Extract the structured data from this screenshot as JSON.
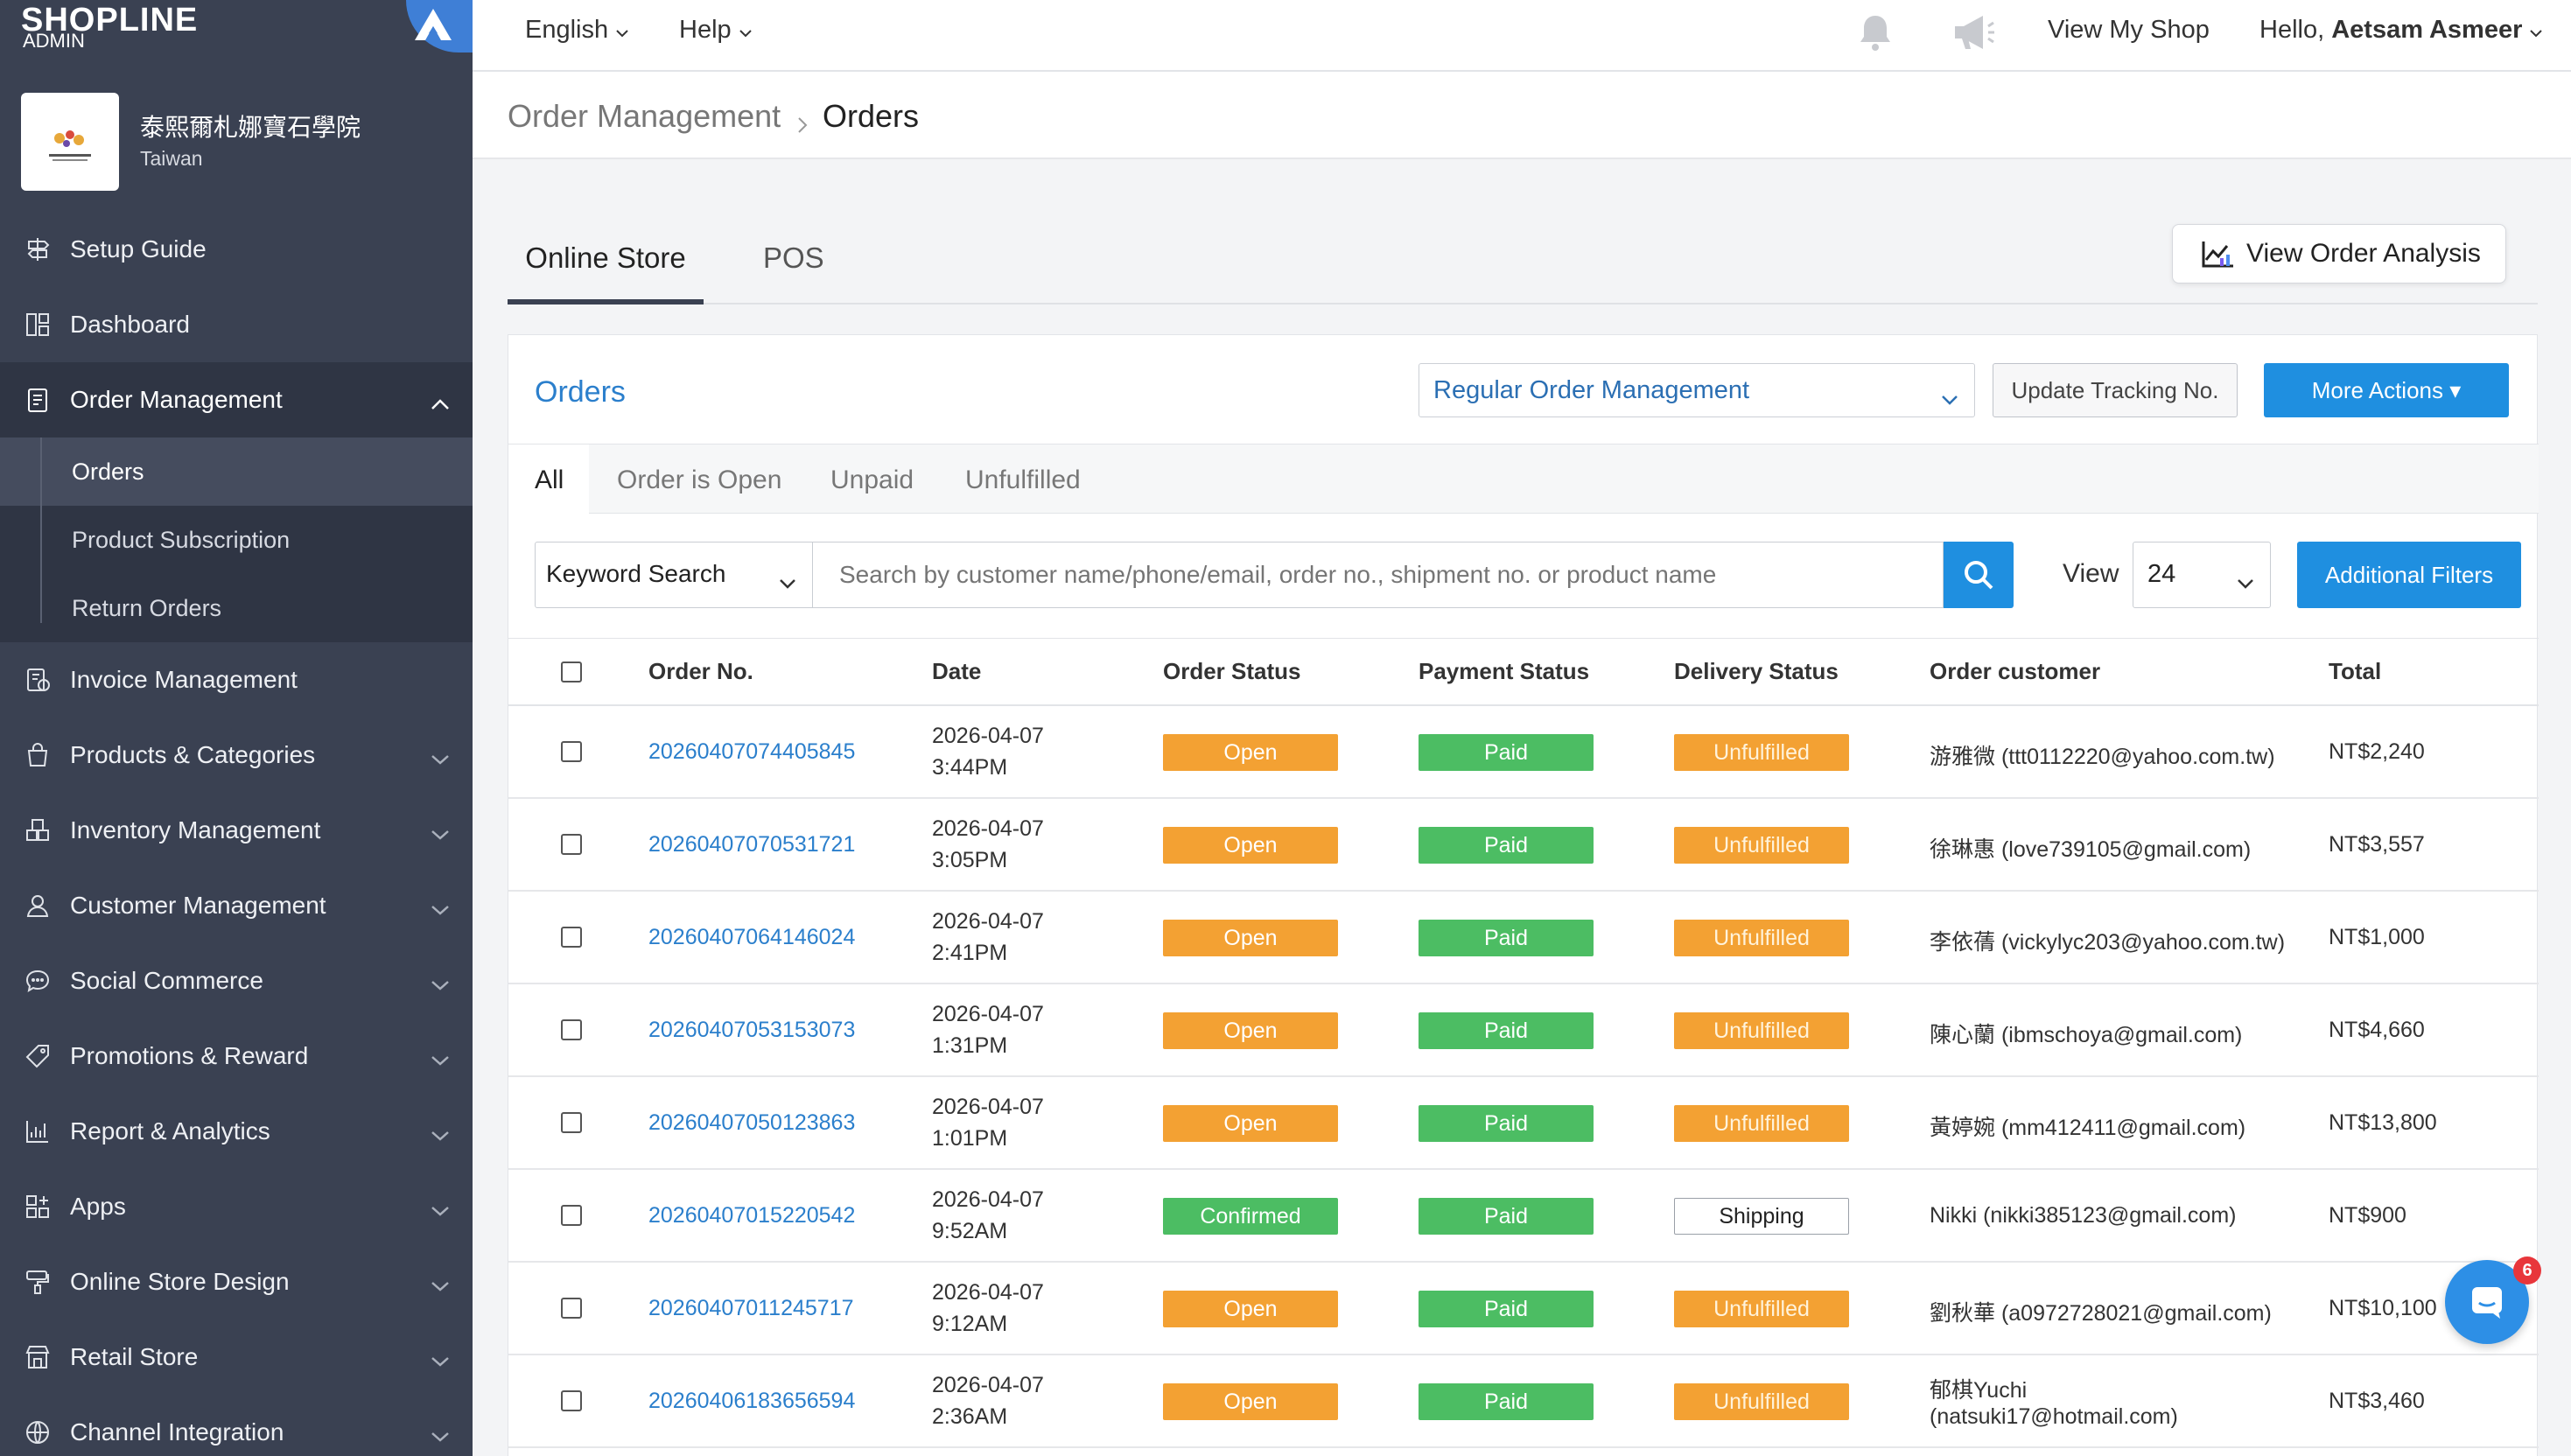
{
  "brand": {
    "logo": "SHOPLINE",
    "sub": "ADMIN"
  },
  "store": {
    "name": "泰熙爾札娜寶石學院",
    "region": "Taiwan"
  },
  "sidebar": {
    "items": [
      {
        "label": "Setup Guide",
        "icon": "signpost-icon"
      },
      {
        "label": "Dashboard",
        "icon": "dashboard-icon"
      },
      {
        "label": "Order Management",
        "icon": "clipboard-icon",
        "expanded": true
      },
      {
        "label": "Invoice Management",
        "icon": "invoice-icon"
      },
      {
        "label": "Products & Categories",
        "icon": "bag-icon"
      },
      {
        "label": "Inventory Management",
        "icon": "boxes-icon"
      },
      {
        "label": "Customer Management",
        "icon": "person-icon"
      },
      {
        "label": "Social Commerce",
        "icon": "chat-icon"
      },
      {
        "label": "Promotions & Reward",
        "icon": "tag-icon"
      },
      {
        "label": "Report & Analytics",
        "icon": "chart-icon"
      },
      {
        "label": "Apps",
        "icon": "apps-icon"
      },
      {
        "label": "Online Store Design",
        "icon": "paint-icon"
      },
      {
        "label": "Retail Store",
        "icon": "store-icon"
      },
      {
        "label": "Channel Integration",
        "icon": "channel-icon"
      }
    ],
    "order_sub": [
      {
        "label": "Orders",
        "current": true
      },
      {
        "label": "Product Subscription"
      },
      {
        "label": "Return Orders"
      }
    ]
  },
  "topbar": {
    "language": "English",
    "help": "Help",
    "view_shop": "View My Shop",
    "greeting": "Hello,",
    "user_name": "Aetsam Asmeer"
  },
  "breadcrumb": {
    "parent": "Order Management",
    "current": "Orders"
  },
  "tabs": {
    "online": "Online Store",
    "pos": "POS"
  },
  "analysis_button": "View Order Analysis",
  "panel": {
    "title": "Orders",
    "mode_select": "Regular Order Management",
    "update_tracking": "Update Tracking No.",
    "more_actions": "More Actions ▾"
  },
  "filter_tabs": [
    "All",
    "Order is Open",
    "Unpaid",
    "Unfulfilled"
  ],
  "search": {
    "type": "Keyword Search",
    "placeholder": "Search by customer name/phone/email, order no., shipment no. or product name",
    "view_label": "View",
    "view_value": "24",
    "additional_filters": "Additional Filters"
  },
  "table": {
    "columns": [
      "Order No.",
      "Date",
      "Order Status",
      "Payment Status",
      "Delivery Status",
      "Order customer",
      "Total"
    ],
    "rows": [
      {
        "order_no": "20260407074405845",
        "date": "2026-04-07",
        "time": "3:44PM",
        "order_status": "Open",
        "payment": "Paid",
        "delivery": "Unfulfilled",
        "customer": "游雅微 (ttt0112220@yahoo.com.tw)",
        "customer2": "",
        "total": "NT$2,240"
      },
      {
        "order_no": "20260407070531721",
        "date": "2026-04-07",
        "time": "3:05PM",
        "order_status": "Open",
        "payment": "Paid",
        "delivery": "Unfulfilled",
        "customer": "徐琳惠 (love739105@gmail.com)",
        "customer2": "",
        "total": "NT$3,557"
      },
      {
        "order_no": "20260407064146024",
        "date": "2026-04-07",
        "time": "2:41PM",
        "order_status": "Open",
        "payment": "Paid",
        "delivery": "Unfulfilled",
        "customer": "李依蒨 (vickylyc203@yahoo.com.tw)",
        "customer2": "",
        "total": "NT$1,000"
      },
      {
        "order_no": "20260407053153073",
        "date": "2026-04-07",
        "time": "1:31PM",
        "order_status": "Open",
        "payment": "Paid",
        "delivery": "Unfulfilled",
        "customer": "陳心蘭 (ibmschoya@gmail.com)",
        "customer2": "",
        "total": "NT$4,660"
      },
      {
        "order_no": "20260407050123863",
        "date": "2026-04-07",
        "time": "1:01PM",
        "order_status": "Open",
        "payment": "Paid",
        "delivery": "Unfulfilled",
        "customer": "黃婷婉 (mm412411@gmail.com)",
        "customer2": "",
        "total": "NT$13,800"
      },
      {
        "order_no": "20260407015220542",
        "date": "2026-04-07",
        "time": "9:52AM",
        "order_status": "Confirmed",
        "payment": "Paid",
        "delivery": "Shipping",
        "customer": "Nikki (nikki385123@gmail.com)",
        "customer2": "",
        "total": "NT$900"
      },
      {
        "order_no": "20260407011245717",
        "date": "2026-04-07",
        "time": "9:12AM",
        "order_status": "Open",
        "payment": "Paid",
        "delivery": "Unfulfilled",
        "customer": "劉秋華 (a0972728021@gmail.com)",
        "customer2": "",
        "total": "NT$10,100"
      },
      {
        "order_no": "20260406183656594",
        "date": "2026-04-07",
        "time": "2:36AM",
        "order_status": "Open",
        "payment": "Paid",
        "delivery": "Unfulfilled",
        "customer": "郁棋Yuchi",
        "customer2": "(natsuki17@hotmail.com)",
        "total": "NT$3,460"
      }
    ]
  },
  "chat": {
    "badge": "6"
  },
  "colors": {
    "sidebar": "#3a4152",
    "accent": "#1f8fe0",
    "open": "#f3a133",
    "paid": "#4cbd63"
  }
}
